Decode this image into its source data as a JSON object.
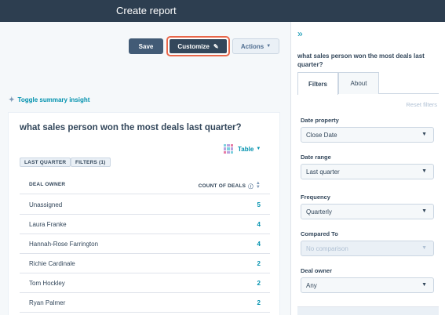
{
  "topbar": {
    "title": "Create report"
  },
  "toolbar": {
    "save_label": "Save",
    "customize_label": "Customize",
    "customize_icon": "pencil-icon",
    "actions_label": "Actions",
    "highlight_color": "#e8674a"
  },
  "summary_toggle": {
    "label": "Toggle summary insight"
  },
  "report": {
    "title": "what sales person won the most deals last quarter?",
    "viz_label": "Table",
    "tags": [
      "LAST QUARTER",
      "FILTERS (1)"
    ],
    "columns": {
      "owner": "DEAL OWNER",
      "count": "COUNT OF DEALS"
    },
    "rows": [
      {
        "owner": "Unassigned",
        "count": "5"
      },
      {
        "owner": "Laura Franke",
        "count": "4"
      },
      {
        "owner": "Hannah-Rose Farrington",
        "count": "4"
      },
      {
        "owner": "Richie Cardinale",
        "count": "2"
      },
      {
        "owner": "Tom Hockley",
        "count": "2"
      },
      {
        "owner": "Ryan Palmer",
        "count": "2"
      }
    ]
  },
  "panel": {
    "collapse_icon": "double-chevron-right-icon",
    "title": "what sales person won the most deals last quarter?",
    "tabs": [
      "Filters",
      "About"
    ],
    "active_tab": "Filters",
    "reset_label": "Reset filters",
    "filters": [
      {
        "label": "Date property",
        "value": "Close Date",
        "disabled": false
      },
      {
        "label": "Date range",
        "value": "Last quarter",
        "disabled": false
      },
      {
        "label": "Frequency",
        "value": "Quarterly",
        "disabled": false
      },
      {
        "label": "Compared To",
        "value": "No comparison",
        "disabled": true
      },
      {
        "label": "Deal owner",
        "value": "Any",
        "disabled": false
      }
    ]
  }
}
